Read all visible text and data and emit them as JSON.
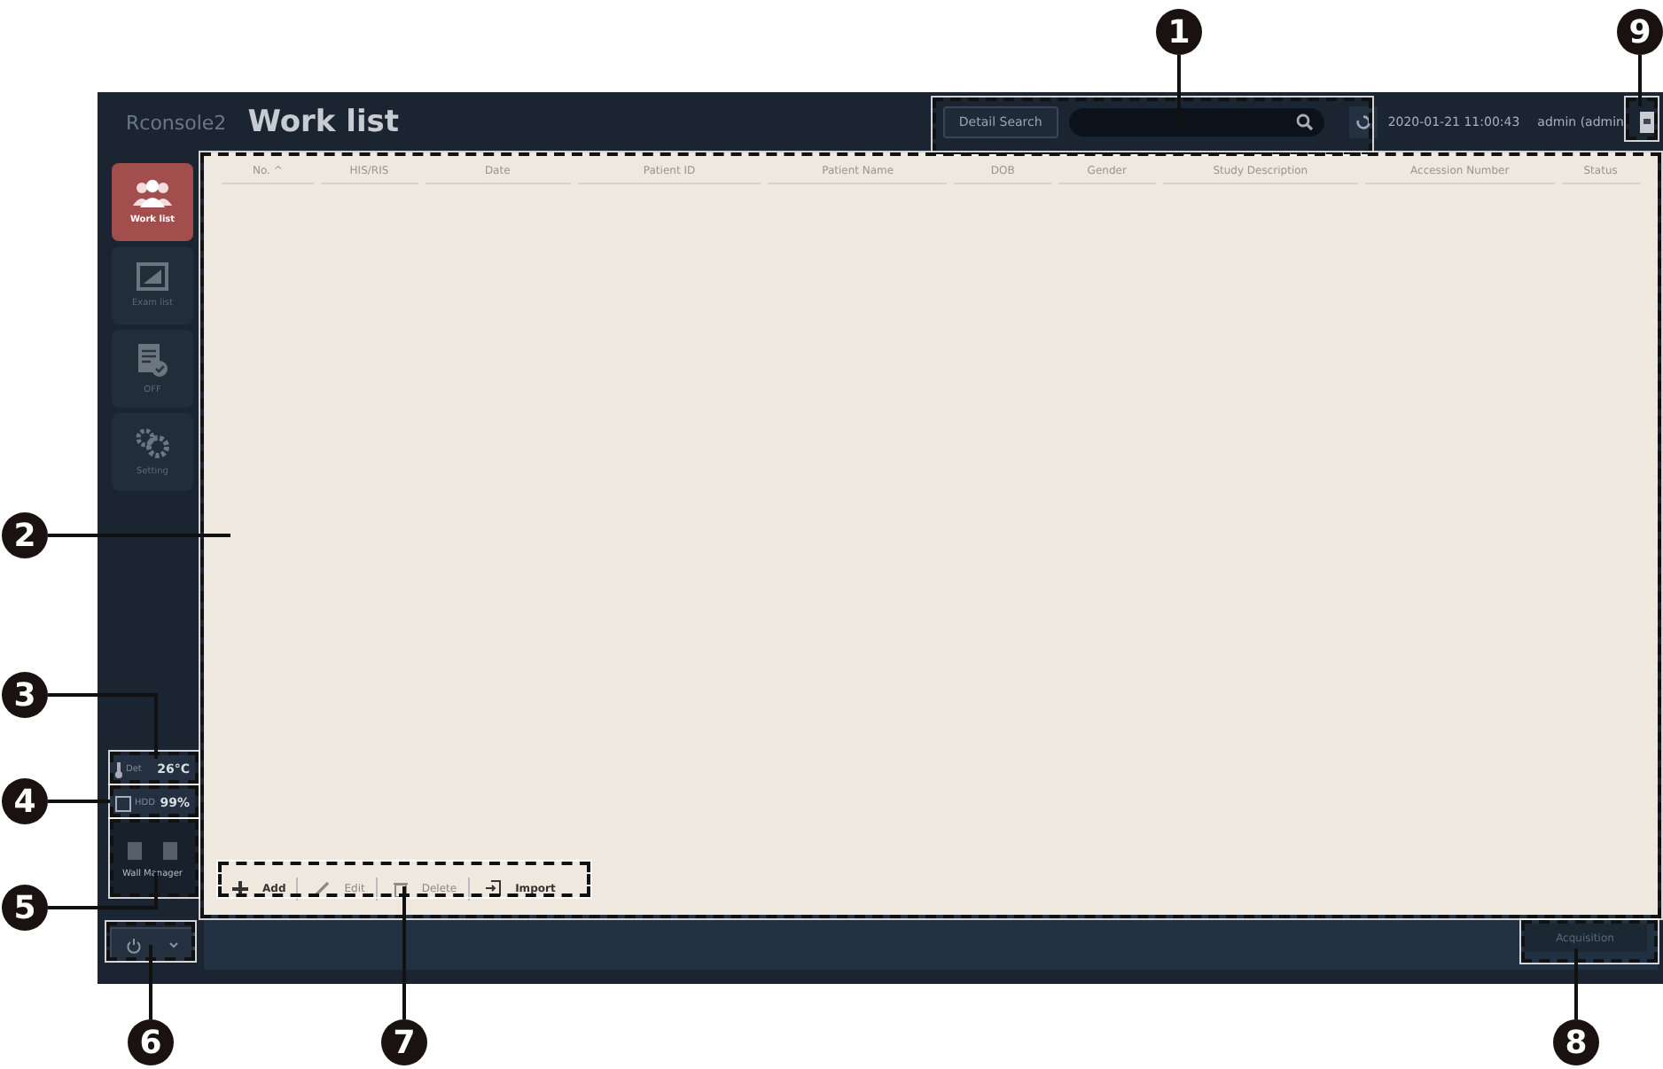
{
  "header": {
    "app_name": "Rconsole2",
    "title": "Work list",
    "detail_search": "Detail Search",
    "datetime": "2020-01-21 11:00:43",
    "user": "admin (admin"
  },
  "sidebar": {
    "items": [
      {
        "label": "Work list",
        "selected": true
      },
      {
        "label": "Exam list",
        "selected": false
      },
      {
        "label": "OFF",
        "selected": false
      },
      {
        "label": "Setting",
        "selected": false
      }
    ],
    "temperature": {
      "label": "Det",
      "value": "26°C"
    },
    "storage": {
      "label": "HDD",
      "value": "99%"
    },
    "wall_manager": "Wall Manager"
  },
  "table": {
    "columns": [
      {
        "label": "No. ^"
      },
      {
        "label": "HIS/RIS"
      },
      {
        "label": "Date"
      },
      {
        "label": "Patient ID"
      },
      {
        "label": "Patient Name"
      },
      {
        "label": "DOB"
      },
      {
        "label": "Gender"
      },
      {
        "label": "Study Description"
      },
      {
        "label": "Accession Number"
      },
      {
        "label": "Status"
      }
    ]
  },
  "toolbar": [
    {
      "label": "Add",
      "disabled": false
    },
    {
      "label": "Edit",
      "disabled": true
    },
    {
      "label": "Delete",
      "disabled": true
    },
    {
      "label": "Import",
      "disabled": false
    }
  ],
  "footer": {
    "acquisition": "Acquisition"
  },
  "callouts": [
    "1",
    "2",
    "3",
    "4",
    "5",
    "6",
    "7",
    "8",
    "9"
  ]
}
